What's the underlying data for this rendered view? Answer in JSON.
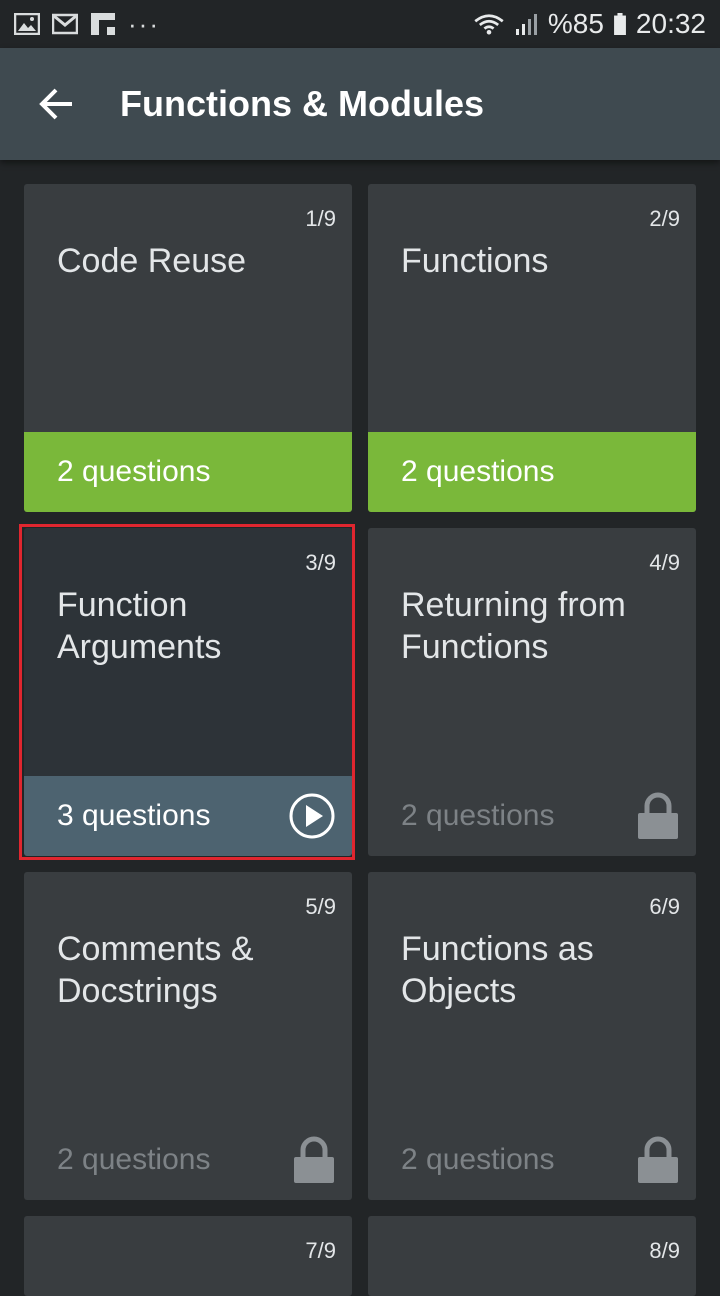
{
  "status_bar": {
    "battery": "%85",
    "time": "20:32",
    "dots": "···"
  },
  "app_bar": {
    "title": "Functions & Modules"
  },
  "lessons": [
    {
      "index": "1/9",
      "title": "Code Reuse",
      "footer": "2 questions",
      "state": "done"
    },
    {
      "index": "2/9",
      "title": "Functions",
      "footer": "2 questions",
      "state": "done"
    },
    {
      "index": "3/9",
      "title": "Function Arguments",
      "footer": "3 questions",
      "state": "current"
    },
    {
      "index": "4/9",
      "title": "Returning from Functions",
      "footer": "2 questions",
      "state": "locked"
    },
    {
      "index": "5/9",
      "title": "Comments & Docstrings",
      "footer": "2 questions",
      "state": "locked"
    },
    {
      "index": "6/9",
      "title": "Functions as Objects",
      "footer": "2 questions",
      "state": "locked"
    },
    {
      "index": "7/9",
      "title": "",
      "footer": "",
      "state": "partial"
    },
    {
      "index": "8/9",
      "title": "",
      "footer": "",
      "state": "partial"
    }
  ],
  "colors": {
    "done": "#7ab83a",
    "current": "#4d6370",
    "highlight": "#e0262f"
  }
}
